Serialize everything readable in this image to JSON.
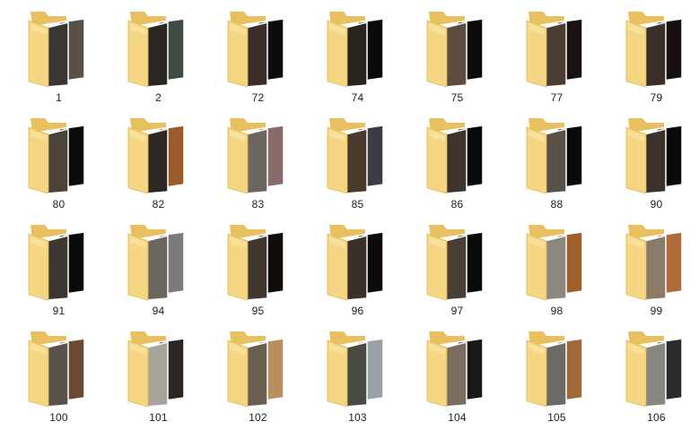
{
  "folders": [
    {
      "name": "1",
      "photo_a": "#3a3634",
      "photo_b": "#5a5048"
    },
    {
      "name": "2",
      "photo_a": "#2b2623",
      "photo_b": "#3e4a42"
    },
    {
      "name": "72",
      "photo_a": "#3a2f28",
      "photo_b": "#0e0c0b"
    },
    {
      "name": "74",
      "photo_a": "#2a2420",
      "photo_b": "#0c0a09"
    },
    {
      "name": "75",
      "photo_a": "#5a4d40",
      "photo_b": "#0d0b0a"
    },
    {
      "name": "77",
      "photo_a": "#4a3e34",
      "photo_b": "#1a1210"
    },
    {
      "name": "79",
      "photo_a": "#3a3029",
      "photo_b": "#15100e"
    },
    {
      "name": "80",
      "photo_a": "#4b423a",
      "photo_b": "#0c0a0a"
    },
    {
      "name": "82",
      "photo_a": "#2e2823",
      "photo_b": "#9a5a2a"
    },
    {
      "name": "83",
      "photo_a": "#6c6660",
      "photo_b": "#8a6a6a"
    },
    {
      "name": "85",
      "photo_a": "#4a3a2c",
      "photo_b": "#3c3c44"
    },
    {
      "name": "86",
      "photo_a": "#3e342c",
      "photo_b": "#0c0909"
    },
    {
      "name": "88",
      "photo_a": "#5a5047",
      "photo_b": "#0b0908"
    },
    {
      "name": "90",
      "photo_a": "#3c322b",
      "photo_b": "#0c0a09"
    },
    {
      "name": "91",
      "photo_a": "#3e3630",
      "photo_b": "#0c0a09"
    },
    {
      "name": "94",
      "photo_a": "#6a665f",
      "photo_b": "#7a7a7a"
    },
    {
      "name": "95",
      "photo_a": "#3f362e",
      "photo_b": "#0f0c0a"
    },
    {
      "name": "96",
      "photo_a": "#3a302a",
      "photo_b": "#0d0a09"
    },
    {
      "name": "97",
      "photo_a": "#4a3f35",
      "photo_b": "#0c0a09"
    },
    {
      "name": "98",
      "photo_a": "#8a8880",
      "photo_b": "#a0602c"
    },
    {
      "name": "99",
      "photo_a": "#8a7a6a",
      "photo_b": "#b06a3a"
    },
    {
      "name": "100",
      "photo_a": "#5a534c",
      "photo_b": "#6a4a34"
    },
    {
      "name": "101",
      "photo_a": "#a8a49c",
      "photo_b": "#2a2624"
    },
    {
      "name": "102",
      "photo_a": "#6a5e50",
      "photo_b": "#b89060"
    },
    {
      "name": "103",
      "photo_a": "#4a4a44",
      "photo_b": "#9aa0a8"
    },
    {
      "name": "104",
      "photo_a": "#7a6e60",
      "photo_b": "#1a1816"
    },
    {
      "name": "105",
      "photo_a": "#6a6a66",
      "photo_b": "#a06a3a"
    },
    {
      "name": "106",
      "photo_a": "#8a8680",
      "photo_b": "#2a2a2c"
    }
  ],
  "colors": {
    "folder_back": "#e8c060",
    "folder_front": "#f5d682",
    "folder_front_edge": "#e0b85a",
    "label_text": "#1e1e1e"
  }
}
